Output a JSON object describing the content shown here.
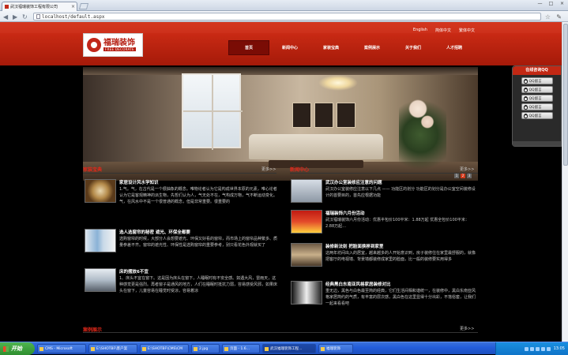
{
  "browser": {
    "tab_title": "武汉福瑞装饰工程有限公司",
    "tab_close": "×",
    "url": "localhost/default.aspx",
    "window_buttons": [
      "—",
      "□",
      "×"
    ]
  },
  "header": {
    "languages": [
      "English",
      "简体中文",
      "繁体中文"
    ],
    "logo_cn": "福瑞装饰",
    "logo_en": "FREE DECORATE",
    "nav": [
      "首页",
      "新闻中心",
      "家装宝典",
      "案例展示",
      "关于我们",
      "人才招聘"
    ],
    "active_nav": 0
  },
  "banner": {
    "slides": [
      "1",
      "2",
      "3"
    ],
    "active_slide": 0
  },
  "qq_panel": {
    "title": "在线咨询QQ",
    "buttons": [
      "QQ留言",
      "QQ留言",
      "QQ留言",
      "QQ留言",
      "QQ留言"
    ]
  },
  "home_tips": {
    "title": "家装宝典",
    "more": "更多>>",
    "items": [
      {
        "title": "家居设计风水学知识",
        "desc": "1.气。气，在古代是一个很抽象的概念。唯物论者认为它是构成世界本原的元素，唯心论者认为它是客观精神的派生物，先哲们认为人，气无处不在，气构成万物，气不断运动变化。气，在风水中不是一个很普通的概念，但是非常重要。很重要的"
      },
      {
        "title": "选人选窗帘的秘密  遮光、环保全都要",
        "desc": "选购窗帘的时候，大部分人会想要遮光、环保又好看的窗帘，而市场上的窗帘品种繁多、质量参差不齐。窗帘的遮光性、环保性是选购窗帘的重要参考，别只看花色外观就买了"
      },
      {
        "title": "床的摆放6不宜",
        "desc": "1、床头不宜在窗下。这是因为床头在窗下，人睡眠时有不安全感。如遇大风，雷雨天，这种感觉更是强烈。再者窗子是通风的地方，人们在睡眠时抵抗力弱，容易感受风邪，如果床头在窗下，儿童容易在睡觉时受凉，容易着凉"
      }
    ]
  },
  "news_center": {
    "title": "新闻中心",
    "more": "更多>>",
    "items": [
      {
        "title": "武汉办公室装修应注意的问题",
        "desc": "武汉办公室装修应注意以下几点 —— 功能区的划分 功能区的划分是办公室空间装修设计的首要目的，首先应根据功能"
      },
      {
        "title": "福瑞装饰六月份活动",
        "desc": "武汉福瑞装饰六月份活动：优惠半包价100平米：1.88万起 优惠全包价100平米：2.88万起…"
      },
      {
        "title": "装修新法则  把脸面换移到家里",
        "desc": "这两年坊间出入的居室，越来越多的人开始意识到，房子装修住在家里最舒服的，就像把客厅的电视墙、背景墙都装修成家里的脸面，比一般的装修要实用得多"
      },
      {
        "title": "经典黑白东南亚风格家居装修对比",
        "desc": "重无边，黑色与白色最至简的经典，它们生活间相和谐统一，在装修中，黑白东南亚风格家居简约的气质，有丰富的层次感，黑白色在这里显得十分出彩，不落俗套，让我们一起来看看吧"
      }
    ]
  },
  "cases": {
    "title": "案例展示",
    "more": "更多>>"
  },
  "taskbar": {
    "start": "开始",
    "tasks": [
      "CMS - Microsoft",
      "E:\\SHOTBF\\客户案",
      "E:\\SHOTBF\\CMS\\CM",
      "2.jpg",
      "页面 - 1.6…",
      "武汉福瑞装饰工程…",
      "福瑞装饰"
    ],
    "active_task": 5,
    "clock": "13:05"
  },
  "colors": {
    "brand_red": "#c92a14",
    "section_title_red": "#e0281a",
    "page_bg": "#000000"
  }
}
